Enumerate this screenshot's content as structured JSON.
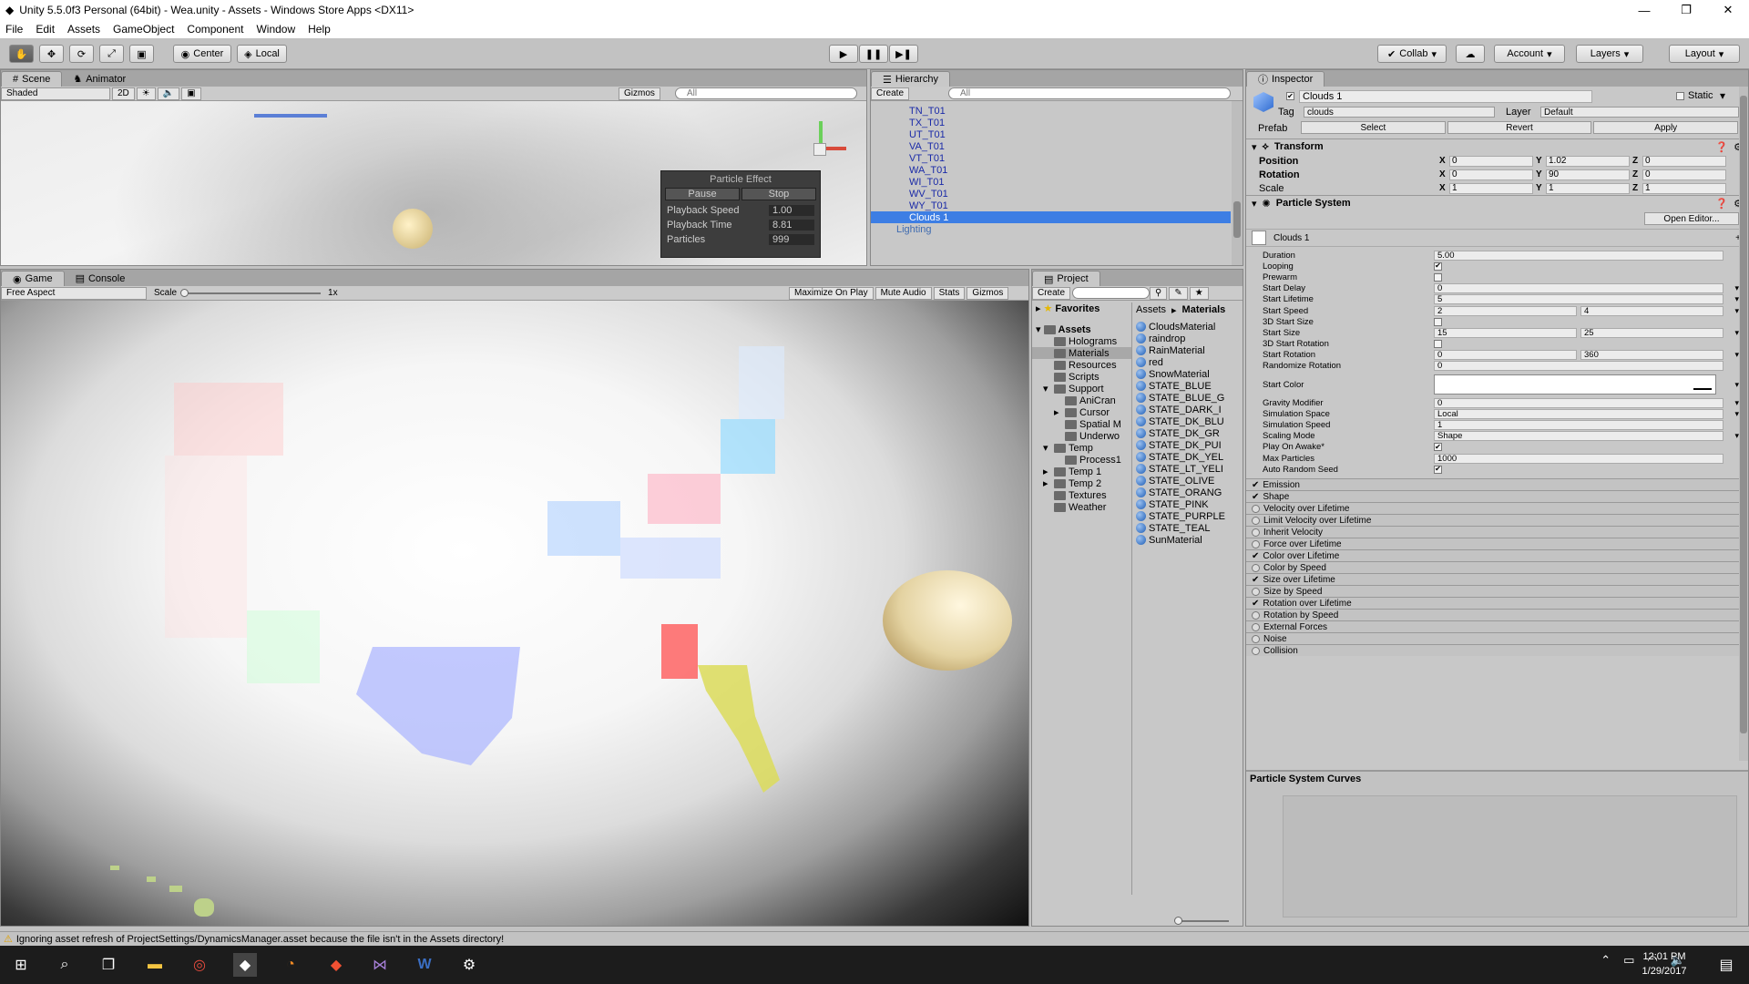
{
  "window": {
    "title": "Unity 5.5.0f3 Personal (64bit) - Wea.unity - Assets - Windows Store Apps <DX11>",
    "minimize": "—",
    "maximize": "❐",
    "close": "✕"
  },
  "menu": [
    "File",
    "Edit",
    "Assets",
    "GameObject",
    "Component",
    "Window",
    "Help"
  ],
  "toolbar": {
    "center": "Center",
    "local": "Local",
    "collab": "Collab",
    "account": "Account",
    "layers": "Layers",
    "layout": "Layout"
  },
  "scene": {
    "tabs": [
      "Scene",
      "Animator"
    ],
    "shading": "Shaded",
    "mode2d": "2D",
    "gizmos": "Gizmos",
    "search_placeholder": "All",
    "particle_effect": {
      "title": "Particle Effect",
      "pause": "Pause",
      "stop": "Stop",
      "rows": [
        {
          "label": "Playback Speed",
          "value": "1.00"
        },
        {
          "label": "Playback Time",
          "value": "8.81"
        },
        {
          "label": "Particles",
          "value": "999"
        }
      ]
    }
  },
  "hierarchy": {
    "tab": "Hierarchy",
    "create": "Create",
    "search_placeholder": "All",
    "items": [
      "TN_T01",
      "TX_T01",
      "UT_T01",
      "VA_T01",
      "VT_T01",
      "WA_T01",
      "WI_T01",
      "WV_T01",
      "WY_T01",
      "Clouds 1",
      "Lighting"
    ],
    "selected_index": 9
  },
  "game": {
    "tabs": [
      "Game",
      "Console"
    ],
    "aspect": "Free Aspect",
    "scale_label": "Scale",
    "scale_value": "1x",
    "buttons": [
      "Maximize On Play",
      "Mute Audio",
      "Stats",
      "Gizmos"
    ]
  },
  "project": {
    "tab": "Project",
    "create": "Create",
    "favorites": "Favorites",
    "assets_root": "Assets",
    "breadcrumb": [
      "Assets",
      "Materials"
    ],
    "folders": [
      {
        "name": "Holograms",
        "depth": 1
      },
      {
        "name": "Materials",
        "depth": 1,
        "selected": true
      },
      {
        "name": "Resources",
        "depth": 1
      },
      {
        "name": "Scripts",
        "depth": 1
      },
      {
        "name": "Support",
        "depth": 1,
        "expanded": true
      },
      {
        "name": "AniCran",
        "depth": 2
      },
      {
        "name": "Cursor",
        "depth": 2
      },
      {
        "name": "Spatial M",
        "depth": 2
      },
      {
        "name": "Underwo",
        "depth": 2
      },
      {
        "name": "Temp",
        "depth": 1,
        "expanded": true
      },
      {
        "name": "Process1",
        "depth": 2
      },
      {
        "name": "Temp 1",
        "depth": 1
      },
      {
        "name": "Temp 2",
        "depth": 1
      },
      {
        "name": "Textures",
        "depth": 1
      },
      {
        "name": "Weather",
        "depth": 1
      }
    ],
    "files": [
      "CloudsMaterial",
      "raindrop",
      "RainMaterial",
      "red",
      "SnowMaterial",
      "STATE_BLUE",
      "STATE_BLUE_G",
      "STATE_DARK_I",
      "STATE_DK_BLU",
      "STATE_DK_GR",
      "STATE_DK_PUI",
      "STATE_DK_YEL",
      "STATE_LT_YELI",
      "STATE_OLIVE",
      "STATE_ORANG",
      "STATE_PINK",
      "STATE_PURPLE",
      "STATE_TEAL",
      "SunMaterial"
    ]
  },
  "inspector": {
    "tab": "Inspector",
    "object_name": "Clouds 1",
    "static_label": "Static",
    "tag_label": "Tag",
    "tag_value": "clouds",
    "layer_label": "Layer",
    "layer_value": "Default",
    "prefab_label": "Prefab",
    "prefab_buttons": [
      "Select",
      "Revert",
      "Apply"
    ],
    "transform": {
      "title": "Transform",
      "rows": [
        {
          "label": "Position",
          "x": "0",
          "y": "1.02",
          "z": "0"
        },
        {
          "label": "Rotation",
          "x": "0",
          "y": "90",
          "z": "0"
        },
        {
          "label": "Scale",
          "x": "1",
          "y": "1",
          "z": "1"
        }
      ]
    },
    "particle_system": {
      "title": "Particle System",
      "open_editor": "Open Editor...",
      "name": "Clouds 1",
      "rows": [
        {
          "label": "Duration",
          "v1": "5.00"
        },
        {
          "label": "Looping",
          "check": true
        },
        {
          "label": "Prewarm",
          "check": false
        },
        {
          "label": "Start Delay",
          "v1": "0",
          "dd": true
        },
        {
          "label": "Start Lifetime",
          "v1": "5",
          "dd": true
        },
        {
          "label": "Start Speed",
          "v1": "2",
          "v2": "4",
          "dd": true
        },
        {
          "label": "3D Start Size",
          "check": false
        },
        {
          "label": "Start Size",
          "v1": "15",
          "v2": "25",
          "dd": true
        },
        {
          "label": "3D Start Rotation",
          "check": false
        },
        {
          "label": "Start Rotation",
          "v1": "0",
          "v2": "360",
          "dd": true
        },
        {
          "label": "Randomize Rotation",
          "v1": "0"
        },
        {
          "label": "Start Color",
          "color": true
        },
        {
          "label": "Gravity Modifier",
          "v1": "0",
          "dd": true
        },
        {
          "label": "Simulation Space",
          "v1": "Local",
          "dd": true
        },
        {
          "label": "Simulation Speed",
          "v1": "1"
        },
        {
          "label": "Scaling Mode",
          "v1": "Shape",
          "dd": true
        },
        {
          "label": "Play On Awake*",
          "check": true
        },
        {
          "label": "Max Particles",
          "v1": "1000"
        },
        {
          "label": "Auto Random Seed",
          "check": true
        }
      ],
      "modules": [
        {
          "name": "Emission",
          "on": true
        },
        {
          "name": "Shape",
          "on": true
        },
        {
          "name": "Velocity over Lifetime",
          "on": false
        },
        {
          "name": "Limit Velocity over Lifetime",
          "on": false
        },
        {
          "name": "Inherit Velocity",
          "on": false
        },
        {
          "name": "Force over Lifetime",
          "on": false
        },
        {
          "name": "Color over Lifetime",
          "on": true
        },
        {
          "name": "Color by Speed",
          "on": false
        },
        {
          "name": "Size over Lifetime",
          "on": true
        },
        {
          "name": "Size by Speed",
          "on": false
        },
        {
          "name": "Rotation over Lifetime",
          "on": true
        },
        {
          "name": "Rotation by Speed",
          "on": false
        },
        {
          "name": "External Forces",
          "on": false
        },
        {
          "name": "Noise",
          "on": false
        },
        {
          "name": "Collision",
          "on": false
        }
      ]
    },
    "curves_title": "Particle System Curves"
  },
  "status": {
    "message": "Ignoring asset refresh of ProjectSettings/DynamicsManager.asset because the file isn't in the Assets directory!"
  },
  "taskbar": {
    "time": "12:01 PM",
    "date": "1/29/2017"
  }
}
